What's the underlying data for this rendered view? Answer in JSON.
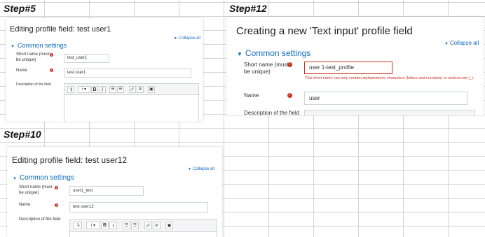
{
  "steps": {
    "s5": "Step#5",
    "s12": "Step#12",
    "s10": "Step#10"
  },
  "shot5": {
    "title": "Editing profile field: test user1",
    "collapse_all": "Collapse all",
    "section": "Common settings",
    "short_name_label": "Short name (must be unique)",
    "short_name_value": "test_user1",
    "name_label": "Name",
    "name_value": "test user1",
    "description_label": "Description of the field",
    "toolbar": [
      "↴",
      "i ▾",
      "B",
      "I",
      "☰",
      "☰",
      "🔗",
      "⊘",
      "▣"
    ]
  },
  "shot12": {
    "title": "Creating a new 'Text input' profile field",
    "collapse_all": "Collapse all",
    "section": "Common settings",
    "short_name_label": "Short name (must be unique)",
    "short_name_value": "user 1-test_profile",
    "error_message": "This short name can only contain alphanumeric characters (letters and numbers) or underscore (_).",
    "name_label": "Name",
    "name_value": "user",
    "description_label": "Description of the field"
  },
  "shot10": {
    "title": "Editing profile field: test user12",
    "collapse_all": "Collapse all",
    "section": "Common settings",
    "short_name_label": "Short name (must be unique)",
    "short_name_value": "user1_test",
    "name_label": "Name",
    "name_value": "test user12",
    "description_label": "Description of the field",
    "toolbar": [
      "↴",
      "i ▾",
      "B",
      "I",
      "☰",
      "☰",
      "🔗",
      "⊘",
      "▣"
    ]
  },
  "colors": {
    "link": "#0f6cbf",
    "error": "#ca3120"
  }
}
